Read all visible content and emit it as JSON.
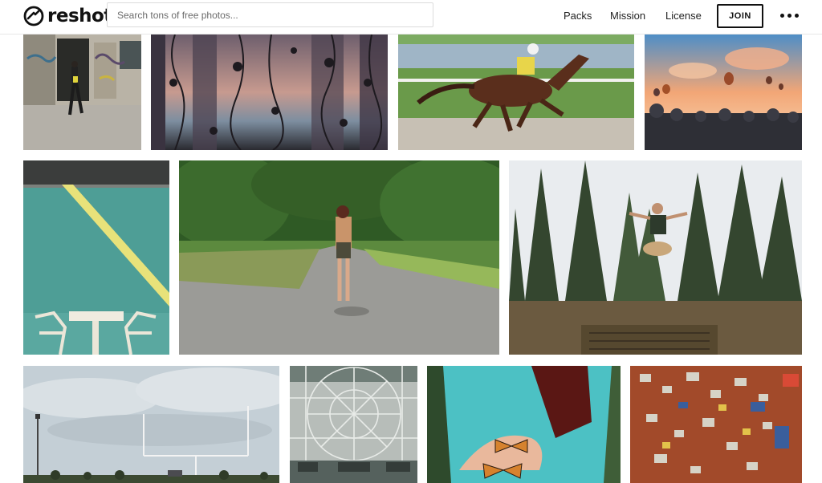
{
  "header": {
    "brand": "reshot",
    "search_placeholder": "Search tons of free photos...",
    "nav": [
      "Packs",
      "Mission",
      "License"
    ],
    "join_label": "JOIN",
    "more_icon": "more-dots-icon"
  },
  "gallery": {
    "photos": [
      "graffiti-street-photo",
      "floral-curtain-sunset-photo",
      "horse-racing-photo",
      "hot-air-balloons-crowd-photo",
      "teal-wall-cafe-chairs-photo",
      "woman-on-forked-path-photo",
      "man-jumping-trees-photo",
      "football-goalpost-field-photo",
      "ferris-wheel-structure-photo",
      "butterflies-in-hands-photo",
      "jigsaw-puzzle-pieces-photo"
    ]
  },
  "colors": {
    "accent": "#111111",
    "border": "#dcdcdc",
    "header_divider": "#e6e6e6"
  }
}
